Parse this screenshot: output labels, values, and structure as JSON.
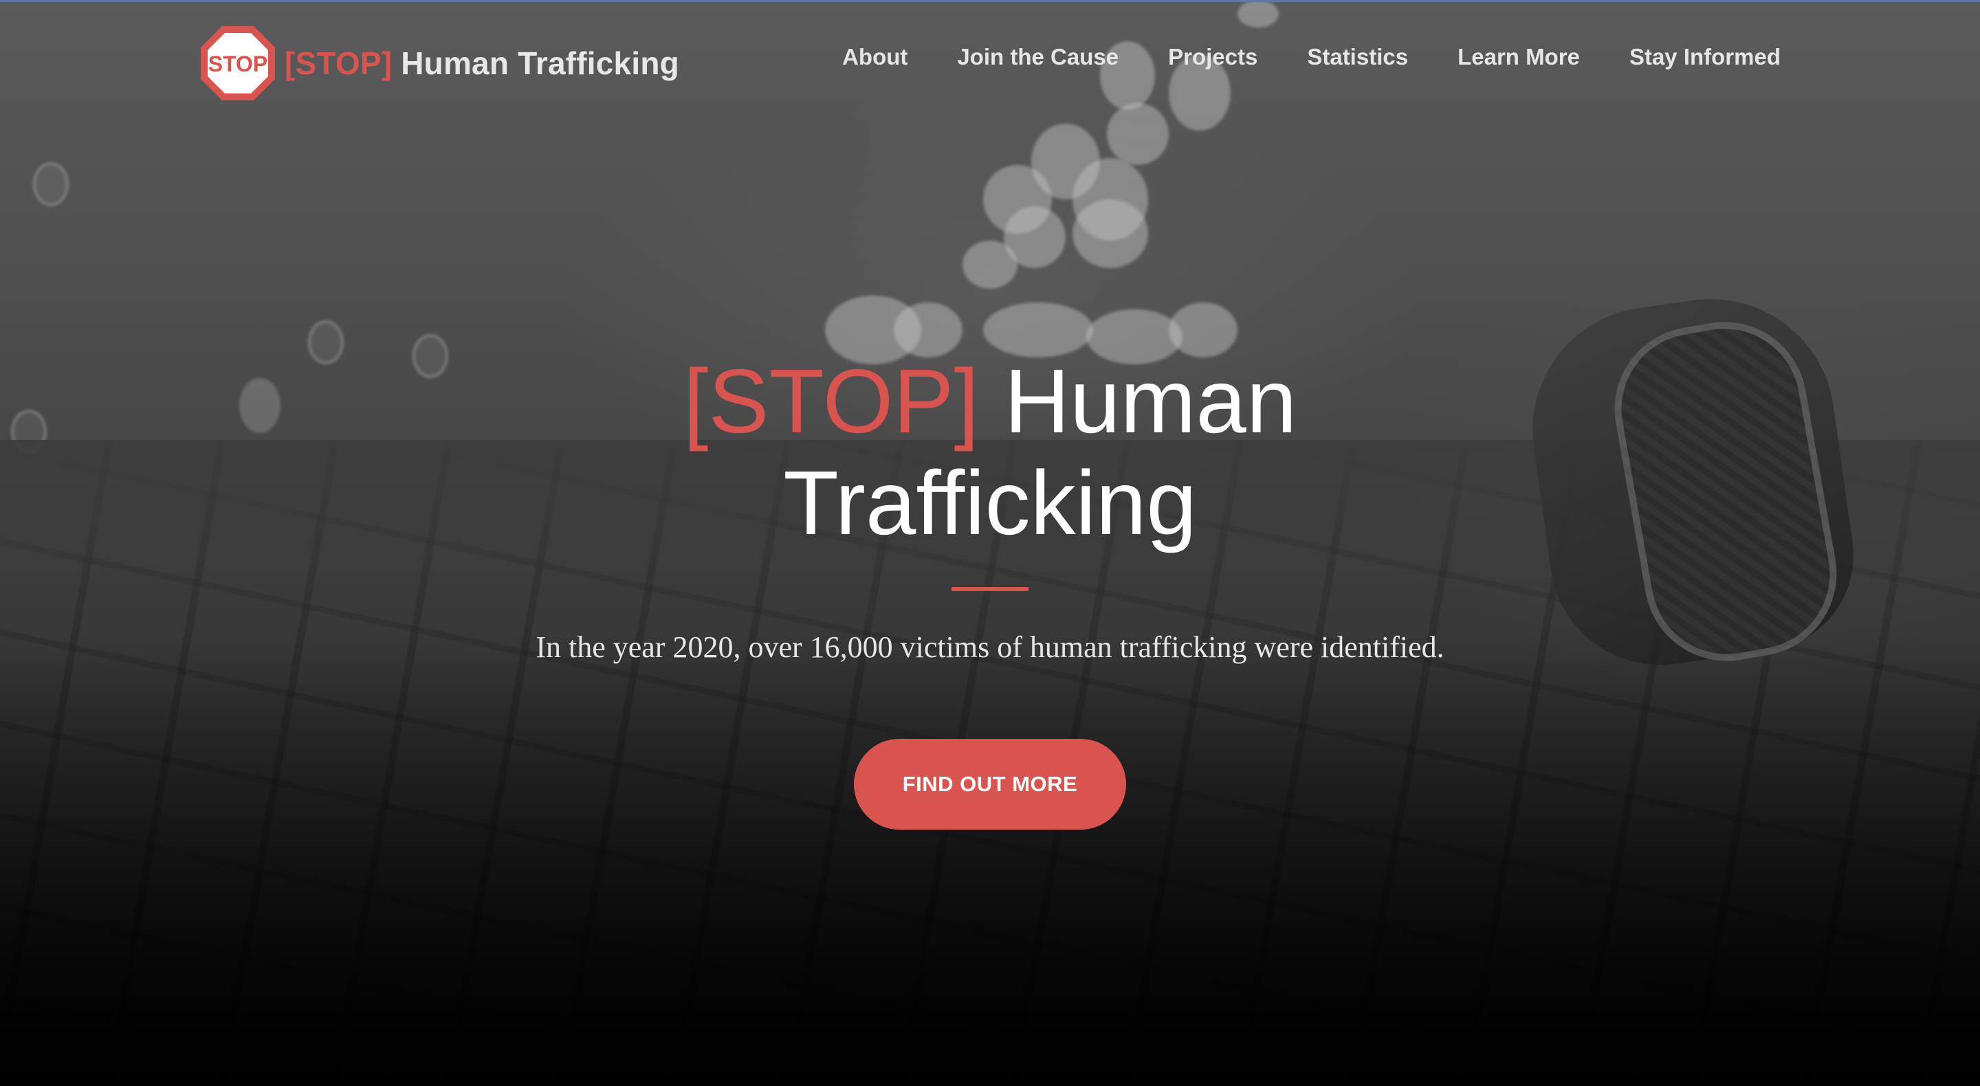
{
  "brand": {
    "logo_text": "STOP",
    "name_accent": "[STOP]",
    "name_rest": "Human Trafficking"
  },
  "nav": {
    "items": [
      {
        "label": "About"
      },
      {
        "label": "Join the Cause"
      },
      {
        "label": "Projects"
      },
      {
        "label": "Statistics"
      },
      {
        "label": "Learn More"
      },
      {
        "label": "Stay Informed"
      }
    ]
  },
  "hero": {
    "title_accent": "[STOP]",
    "title_line1_rest": "Human",
    "title_line2": "Trafficking",
    "subtitle": "In the year 2020, over 16,000 victims of human trafficking were identified.",
    "cta_label": "FIND OUT MORE"
  },
  "colors": {
    "accent": "#d9534f",
    "nav_text": "#e6e6e6",
    "title_text": "#ffffff"
  },
  "icons": {
    "logo": "stop-sign-icon"
  }
}
